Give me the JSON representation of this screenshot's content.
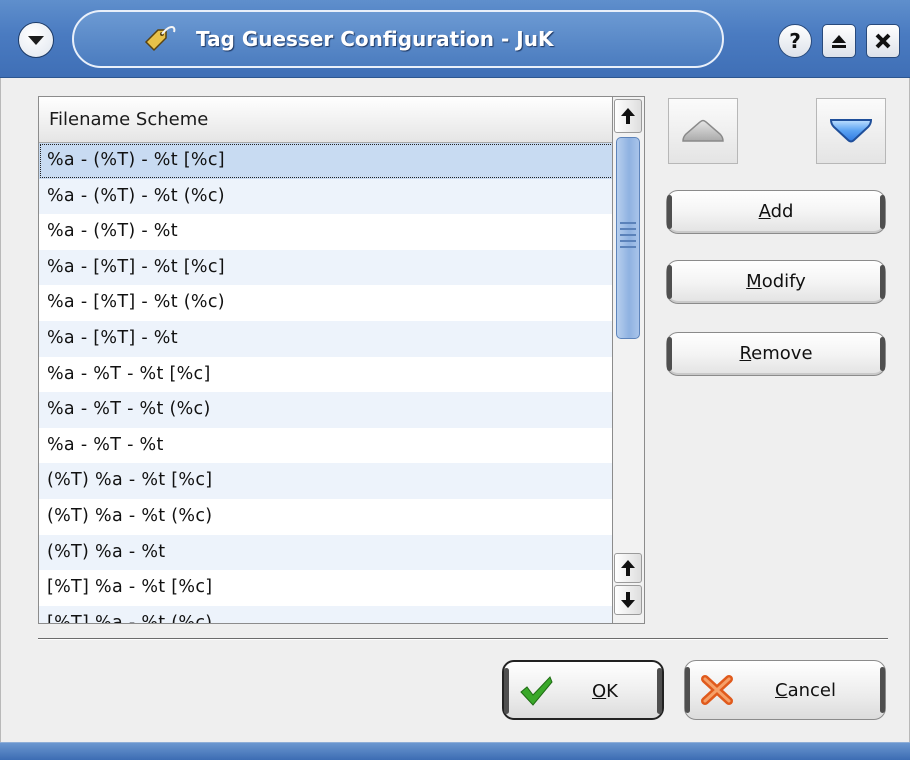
{
  "window": {
    "title": "Tag Guesser Configuration - JuK",
    "help_glyph": "?",
    "icons": {
      "menu": "chevron-down-icon",
      "app": "tag-icon",
      "help": "help-icon",
      "maximize": "maximize-icon",
      "close": "close-icon"
    }
  },
  "list": {
    "header": "Filename Scheme",
    "selected_index": 0,
    "items": [
      "%a - (%T) - %t [%c]",
      "%a - (%T) - %t (%c)",
      "%a - (%T) - %t",
      "%a - [%T] - %t [%c]",
      "%a - [%T] - %t (%c)",
      "%a - [%T] - %t",
      "%a - %T - %t [%c]",
      "%a - %T - %t (%c)",
      "%a - %T - %t",
      "(%T) %a - %t [%c]",
      "(%T) %a - %t (%c)",
      "(%T) %a - %t",
      "[%T] %a - %t [%c]",
      "[%T] %a - %t (%c)"
    ]
  },
  "buttons": {
    "move_up": "arrow-up-icon",
    "move_down": "arrow-down-icon",
    "add": {
      "mnemonic": "A",
      "rest": "dd"
    },
    "modify": {
      "mnemonic": "M",
      "rest": "odify"
    },
    "remove": {
      "mnemonic": "R",
      "rest": "emove"
    }
  },
  "dialog": {
    "ok": {
      "mnemonic": "O",
      "rest": "K",
      "icon": "checkmark-icon"
    },
    "cancel": {
      "mnemonic": "C",
      "rest": "ancel",
      "icon": "cancel-x-icon"
    }
  },
  "colors": {
    "titlebar": "#4a7bc1",
    "selection": "#c8dbf2",
    "alt_row": "#edf3fb",
    "scroll_thumb": "#8fb2e1",
    "ok_check": "#3aa82a",
    "cancel_x": "#e05a1c",
    "down_arrow": "#2f78e0"
  }
}
